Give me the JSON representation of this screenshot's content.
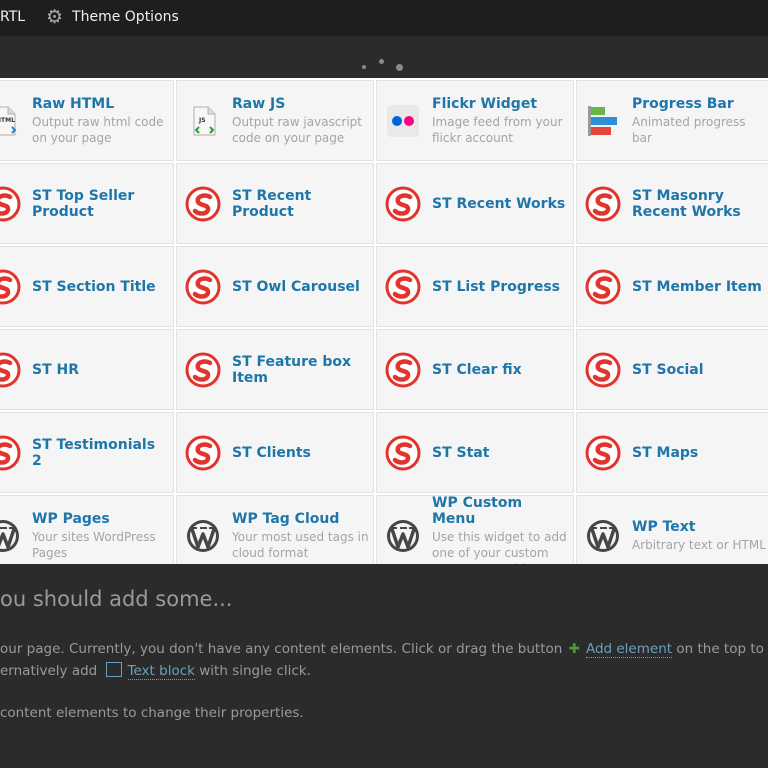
{
  "admin_bar": {
    "rtl_label": "RTL",
    "theme_options_label": "Theme Options"
  },
  "background": {
    "heading": "ou should add some...",
    "line1": {
      "text": "our page. Currently, you don't have any content elements. Click or drag the button",
      "link": "Add element",
      "tail": "on the top to ad"
    },
    "line2": {
      "text": "ernatively add",
      "link": "Text block",
      "tail": "with single click."
    },
    "line3": "content elements to change their properties."
  },
  "elements": [
    {
      "title": "Raw HTML",
      "desc": "Output raw html code on your page",
      "icon": "html-file-icon"
    },
    {
      "title": "Raw JS",
      "desc": "Output raw javascript code on your page",
      "icon": "js-file-icon"
    },
    {
      "title": "Flickr Widget",
      "desc": "Image feed from your flickr account",
      "icon": "flickr-icon"
    },
    {
      "title": "Progress Bar",
      "desc": "Animated progress bar",
      "icon": "progress-bar-icon"
    },
    {
      "title": "ST Top Seller Product",
      "desc": "",
      "icon": "st-logo-icon"
    },
    {
      "title": "ST Recent Product",
      "desc": "",
      "icon": "st-logo-icon"
    },
    {
      "title": "ST Recent Works",
      "desc": "",
      "icon": "st-logo-icon"
    },
    {
      "title": "ST Masonry Recent Works",
      "desc": "",
      "icon": "st-logo-icon"
    },
    {
      "title": "ST Section Title",
      "desc": "",
      "icon": "st-logo-icon"
    },
    {
      "title": "ST Owl Carousel",
      "desc": "",
      "icon": "st-logo-icon"
    },
    {
      "title": "ST List Progress",
      "desc": "",
      "icon": "st-logo-icon"
    },
    {
      "title": "ST Member Item",
      "desc": "",
      "icon": "st-logo-icon"
    },
    {
      "title": "ST HR",
      "desc": "",
      "icon": "st-logo-icon"
    },
    {
      "title": "ST Feature box Item",
      "desc": "",
      "icon": "st-logo-icon"
    },
    {
      "title": "ST Clear fix",
      "desc": "",
      "icon": "st-logo-icon"
    },
    {
      "title": "ST Social",
      "desc": "",
      "icon": "st-logo-icon"
    },
    {
      "title": "ST Testimonials 2",
      "desc": "",
      "icon": "st-logo-icon"
    },
    {
      "title": "ST Clients",
      "desc": "",
      "icon": "st-logo-icon"
    },
    {
      "title": "ST Stat",
      "desc": "",
      "icon": "st-logo-icon"
    },
    {
      "title": "ST Maps",
      "desc": "",
      "icon": "st-logo-icon"
    },
    {
      "title": "WP Pages",
      "desc": "Your sites WordPress Pages",
      "icon": "wordpress-icon"
    },
    {
      "title": "WP Tag Cloud",
      "desc": "Your most used tags in cloud format",
      "icon": "wordpress-icon"
    },
    {
      "title": "WP Custom Menu",
      "desc": "Use this widget to add one of your custom menus as a widget",
      "icon": "wordpress-icon"
    },
    {
      "title": "WP Text",
      "desc": "Arbitrary text or HTML",
      "icon": "wordpress-icon"
    }
  ],
  "colors": {
    "accent": "#1f76a8",
    "st_red": "#e2332d",
    "tile_bg": "#f5f5f5",
    "overlay": "#2b2b2b"
  }
}
